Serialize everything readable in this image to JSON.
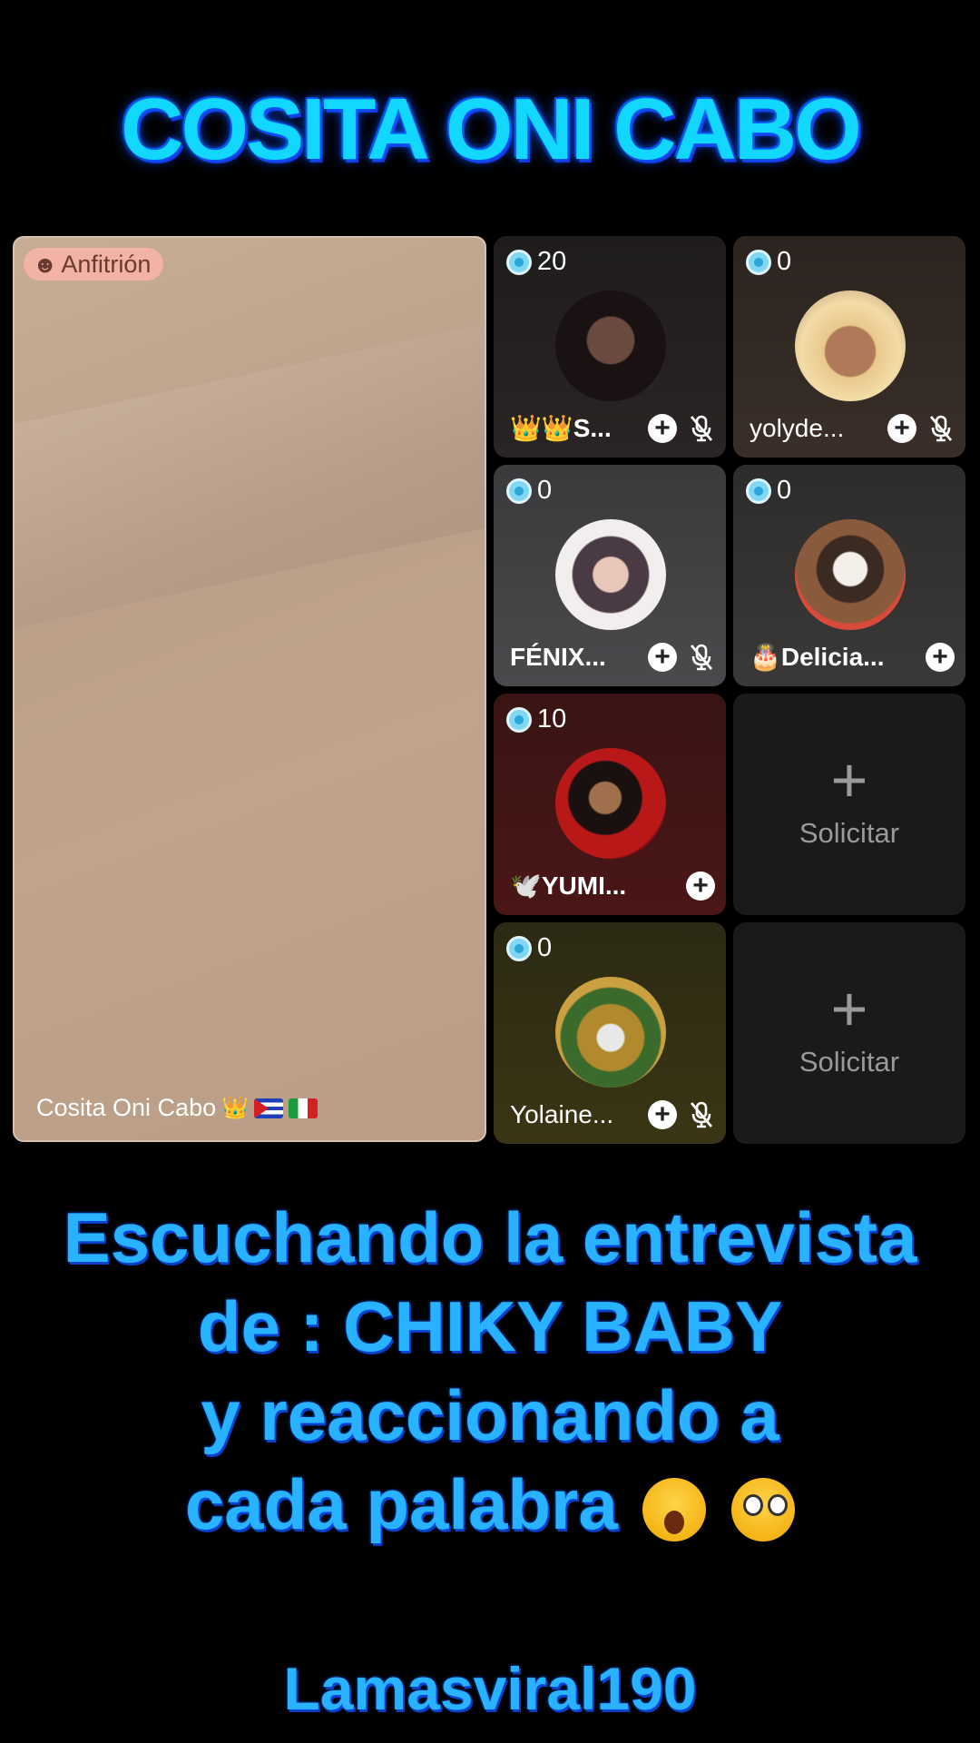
{
  "title": "COSITA ONI CABO",
  "host": {
    "badge_label": "Anfitrión",
    "badge_icon": "person-icon",
    "name": "Cosita Oni Cabo"
  },
  "guests": [
    {
      "coins": "20",
      "name": "👑👑S...",
      "muted": true,
      "avatar_color": "#3a2a28"
    },
    {
      "coins": "0",
      "name": "yolyde...",
      "muted": true,
      "avatar_color": "#d9b07a"
    },
    {
      "coins": "0",
      "name": "FÉNIX...",
      "muted": true,
      "avatar_color": "#efe7e6"
    },
    {
      "coins": "0",
      "name": "🎂Delicia...",
      "muted": false,
      "avatar_color": "#8a6a4c"
    },
    {
      "coins": "10",
      "name": "🕊️YUMI...",
      "muted": false,
      "avatar_color": "#8c1a1a"
    },
    {
      "coins": "0",
      "name": "Yolaine...",
      "muted": true,
      "avatar_color": "#6f6a38"
    }
  ],
  "request_label": "Solicitar",
  "caption": {
    "line1": "Escuchando la entrevista",
    "line2": "de : CHIKY BABY",
    "line3": "y reaccionando a",
    "line4": "cada palabra"
  },
  "footer": "Lamasviral190"
}
